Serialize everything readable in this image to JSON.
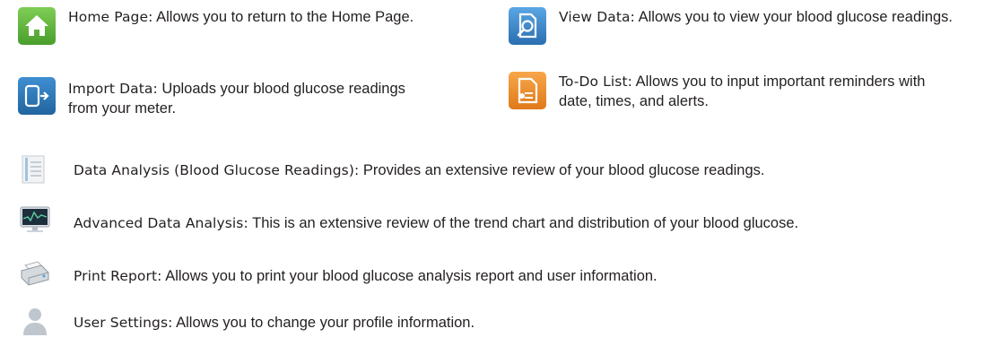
{
  "items": [
    {
      "term": "Home Page:",
      "desc": "Allows you to return to the Home Page.",
      "icon": "home-icon"
    },
    {
      "term": "View Data:",
      "desc": "Allows you to view your blood glucose readings.",
      "icon": "view-data-icon"
    },
    {
      "term": "Import Data:",
      "desc": "Uploads your blood glucose readings from your meter.",
      "icon": "import-data-icon"
    },
    {
      "term": "To-Do List:",
      "desc": "Allows you to input important reminders with date, times, and alerts.",
      "icon": "todo-list-icon"
    },
    {
      "term": "Data Analysis (Blood Glucose Readings):",
      "desc": "Provides an extensive review of your blood glucose readings.",
      "icon": "data-analysis-icon"
    },
    {
      "term": "Advanced Data Analysis:",
      "desc": "This is an extensive review of the trend chart and distribution of your blood glucose.",
      "icon": "advanced-analysis-icon"
    },
    {
      "term": "Print Report:",
      "desc": "Allows you to print your blood glucose analysis report and user information.",
      "icon": "printer-icon"
    },
    {
      "term": "User Settings:",
      "desc": "Allows you to change your profile information.",
      "icon": "user-settings-icon"
    }
  ],
  "colors": {
    "home": "#5fb33c",
    "view_data": "#3b86c8",
    "import_data": "#2f78b8",
    "todo": "#f08a1d"
  }
}
